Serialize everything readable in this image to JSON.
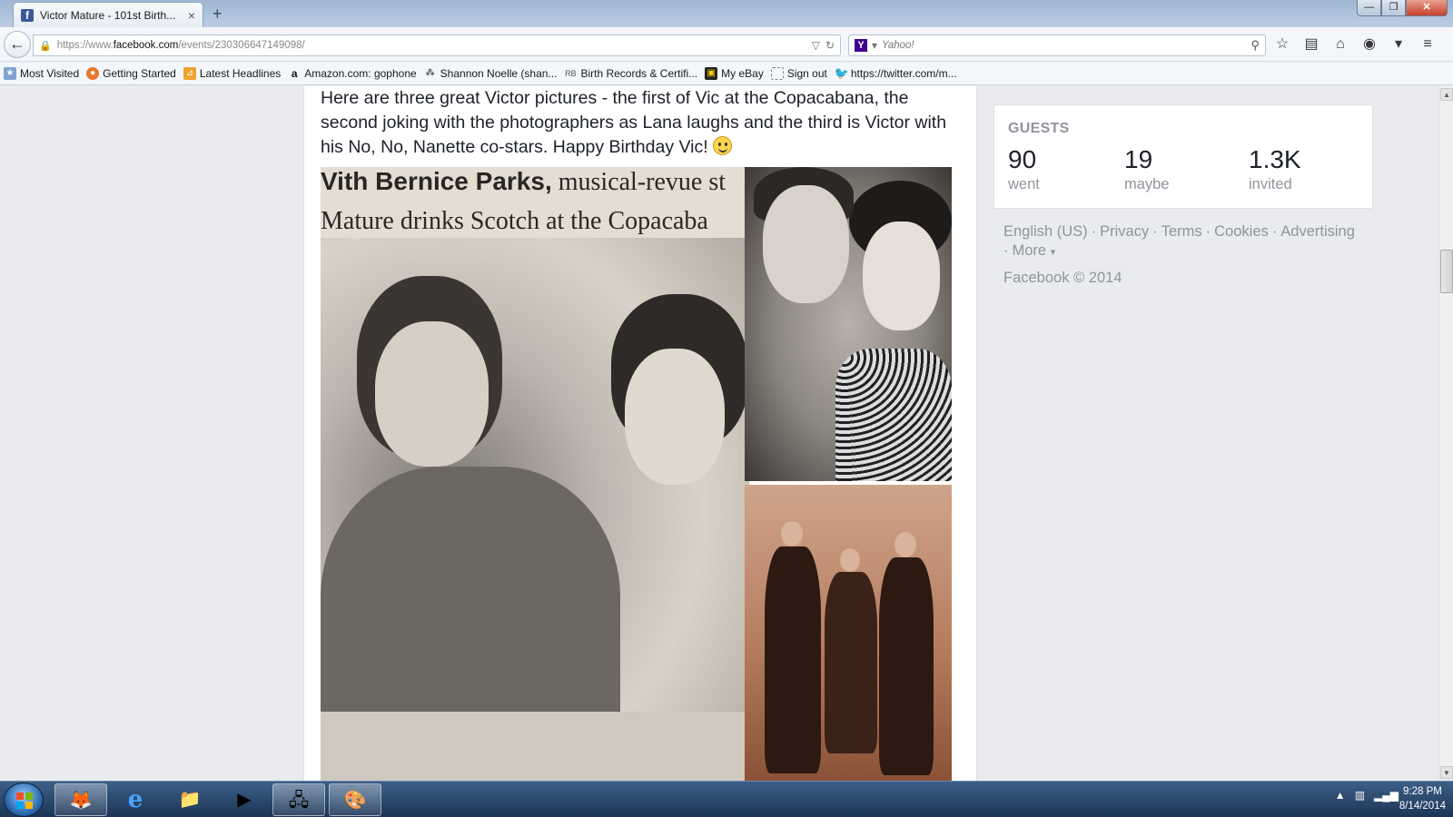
{
  "browser": {
    "tab_title": "Victor Mature - 101st Birth...",
    "tab_close": "×",
    "new_tab": "+",
    "url_prefix": "https://www.",
    "url_domain": "facebook.com",
    "url_path": "/events/230306647149098/",
    "search_placeholder": "Yahoo!",
    "window_controls": {
      "minimize": "—",
      "restore": "❐",
      "close": "✕"
    }
  },
  "bookmarks": [
    {
      "label": "Most Visited",
      "icon": "bookmark-icon"
    },
    {
      "label": "Getting Started",
      "icon": "firefox-icon"
    },
    {
      "label": "Latest Headlines",
      "icon": "rss-icon"
    },
    {
      "label": "Amazon.com: gophone",
      "icon": "amazon-icon"
    },
    {
      "label": "Shannon Noelle (shan...",
      "icon": "people-icon"
    },
    {
      "label": "Birth Records & Certifi...",
      "icon": "records-icon"
    },
    {
      "label": "My eBay",
      "icon": "ebay-icon"
    },
    {
      "label": "Sign out",
      "icon": "page-icon"
    },
    {
      "label": "https://twitter.com/m...",
      "icon": "twitter-icon"
    }
  ],
  "post": {
    "text": "Here are three great Victor pictures - the first of Vic at the Copacabana, the second joking with the photographers as Lana laughs and the third is Victor with his No, No, Nanette co-stars. Happy Birthday Vic!",
    "clipping_line1_bold": "Vith Bernice Parks,",
    "clipping_line1_rest": " musical-revue st",
    "clipping_line2": "Mature drinks Scotch at the Copacaba"
  },
  "guests": {
    "title": "GUESTS",
    "stats": [
      {
        "number": "90",
        "label": "went"
      },
      {
        "number": "19",
        "label": "maybe"
      },
      {
        "number": "1.3K",
        "label": "invited"
      }
    ]
  },
  "footer": {
    "links": [
      "English (US)",
      "Privacy",
      "Terms",
      "Cookies",
      "Advertising"
    ],
    "more": "More",
    "separator": "·",
    "copyright": "Facebook © 2014"
  },
  "taskbar": {
    "apps": [
      "firefox-icon",
      "internet-explorer-icon",
      "file-explorer-icon",
      "media-player-icon",
      "network-icon",
      "paint-icon"
    ],
    "time": "9:28 PM",
    "date": "8/14/2014"
  },
  "colors": {
    "facebook_blue": "#3b5998",
    "muted_text": "#90949c",
    "page_bg": "#e9ebee"
  }
}
